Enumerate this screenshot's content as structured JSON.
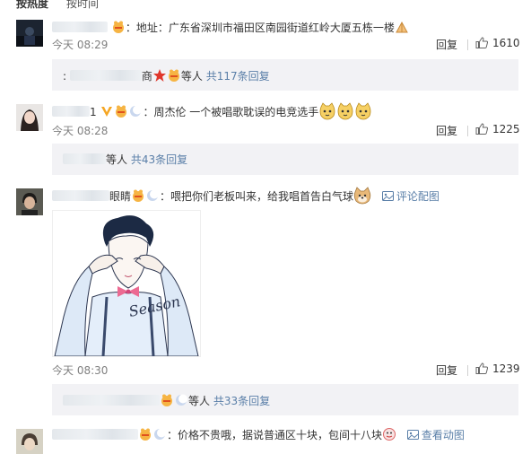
{
  "tabs": {
    "hot": "按热度",
    "time": "按时间"
  },
  "comments": [
    {
      "text": "：地址：广东省深圳市福田区南园街道红岭大厦五栋一楼",
      "time": "今天 08:29",
      "reply": "回复",
      "likes": "1610",
      "sub": {
        "name_tail": "商",
        "suffix": "等人",
        "link": "共117条回复"
      }
    },
    {
      "name_tail": "1",
      "text": "：周杰伦   一个被唱歌耽误的电竞选手",
      "time": "今天 08:28",
      "reply": "回复",
      "likes": "1225",
      "sub": {
        "suffix": "等人",
        "link": "共43条回复"
      }
    },
    {
      "name_tail": "眼睛",
      "text": "：喂把你们老板叫来，给我唱首告白气球",
      "pic_label": "评论配图",
      "time": "今天 08:30",
      "reply": "回复",
      "likes": "1239",
      "sub": {
        "suffix": "等人",
        "link": "共33条回复"
      }
    },
    {
      "text": "：价格不贵哦，据说普通区十块，包间十八块",
      "pic_label": "查看动图"
    }
  ],
  "image_text": "Season"
}
